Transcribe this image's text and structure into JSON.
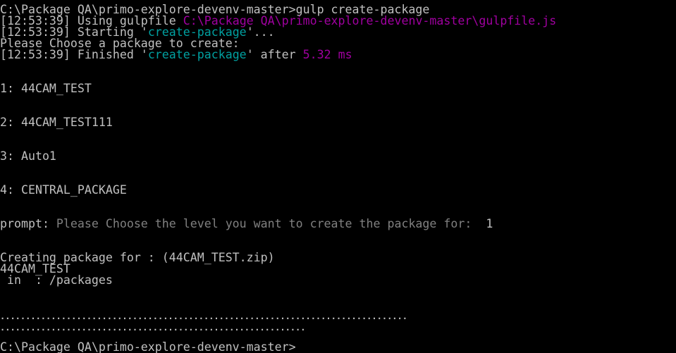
{
  "colors": {
    "background": "#000000",
    "text": "#c0c0c0",
    "path_magenta": "#a000a0",
    "task_cyan": "#00a0a0",
    "prompt_gray": "#808080"
  },
  "terminal": {
    "cmd_line": "C:\\Package QA\\primo-explore-devenv-master>gulp create-package",
    "using_time": "[12:53:39]",
    "using_label": " Using gulpfile ",
    "gulpfile_path": "C:\\Package QA\\primo-explore-devenv-master\\gulpfile.js",
    "starting_time": "[12:53:39]",
    "starting_label": " Starting '",
    "starting_task": "create-package",
    "starting_suffix": "'...",
    "choose_line": "Please Choose a package to create:",
    "finished_time": "[12:53:39]",
    "finished_label": " Finished '",
    "finished_task": "create-package",
    "finished_mid": "' after ",
    "finished_duration": "5.32 ms",
    "options": [
      "1: 44CAM_TEST",
      "2: 44CAM_TEST111",
      "3: Auto1",
      "4: CENTRAL_PACKAGE"
    ],
    "prompt_label": "prompt:",
    "prompt_question": " Please Choose the level you want to create the package for:  ",
    "prompt_answer": "1",
    "creating_line": "Creating package for : (44CAM_TEST.zip)",
    "package_name": "44CAM_TEST",
    "in_line": " in  : /packages",
    "dots_line1": "................................................................................",
    "dots_line2": "............................................................",
    "final_prompt": "C:\\Package QA\\primo-explore-devenv-master>"
  }
}
